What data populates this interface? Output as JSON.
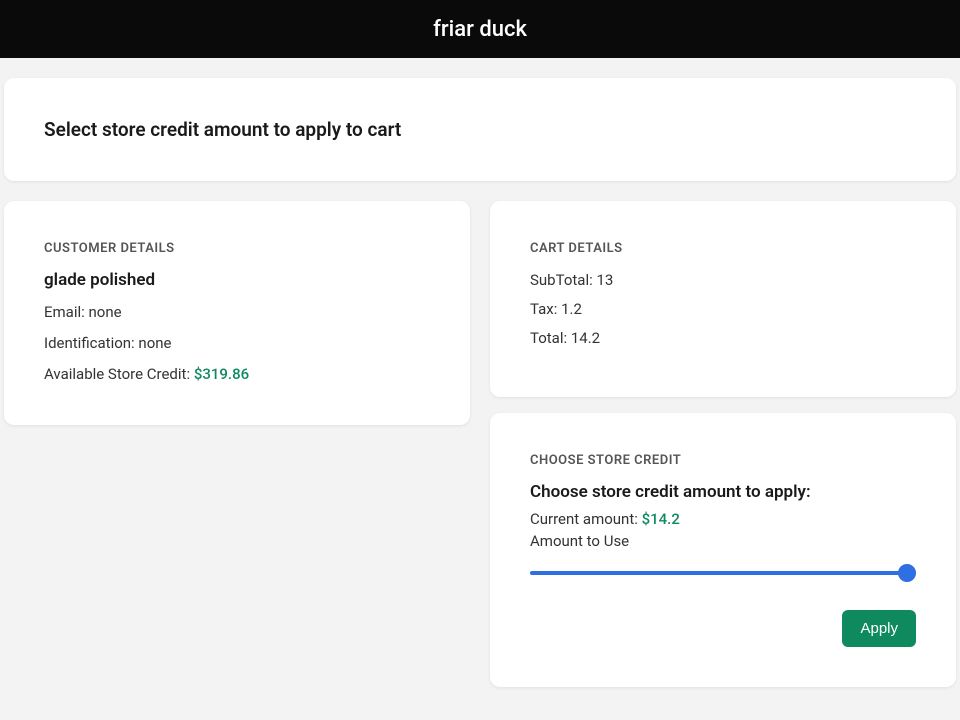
{
  "header": {
    "title": "friar duck"
  },
  "page": {
    "title": "Select store credit amount to apply to cart"
  },
  "customer": {
    "section_label": "CUSTOMER DETAILS",
    "name": "glade polished",
    "email_label": "Email: ",
    "email_value": "none",
    "id_label": "Identification: ",
    "id_value": "none",
    "credit_label": "Available Store Credit: ",
    "credit_value": "$319.86"
  },
  "cart": {
    "section_label": "CART DETAILS",
    "subtotal_label": "SubTotal: ",
    "subtotal_value": "13",
    "tax_label": "Tax: ",
    "tax_value": "1.2",
    "total_label": "Total: ",
    "total_value": "14.2"
  },
  "choose": {
    "section_label": "CHOOSE STORE CREDIT",
    "title": "Choose store credit amount to apply:",
    "current_label": "Current amount: ",
    "current_value": "$14.2",
    "slider_label": "Amount to Use",
    "slider_min": "0",
    "slider_max": "14.2",
    "slider_value": "14.2",
    "apply_label": "Apply"
  }
}
